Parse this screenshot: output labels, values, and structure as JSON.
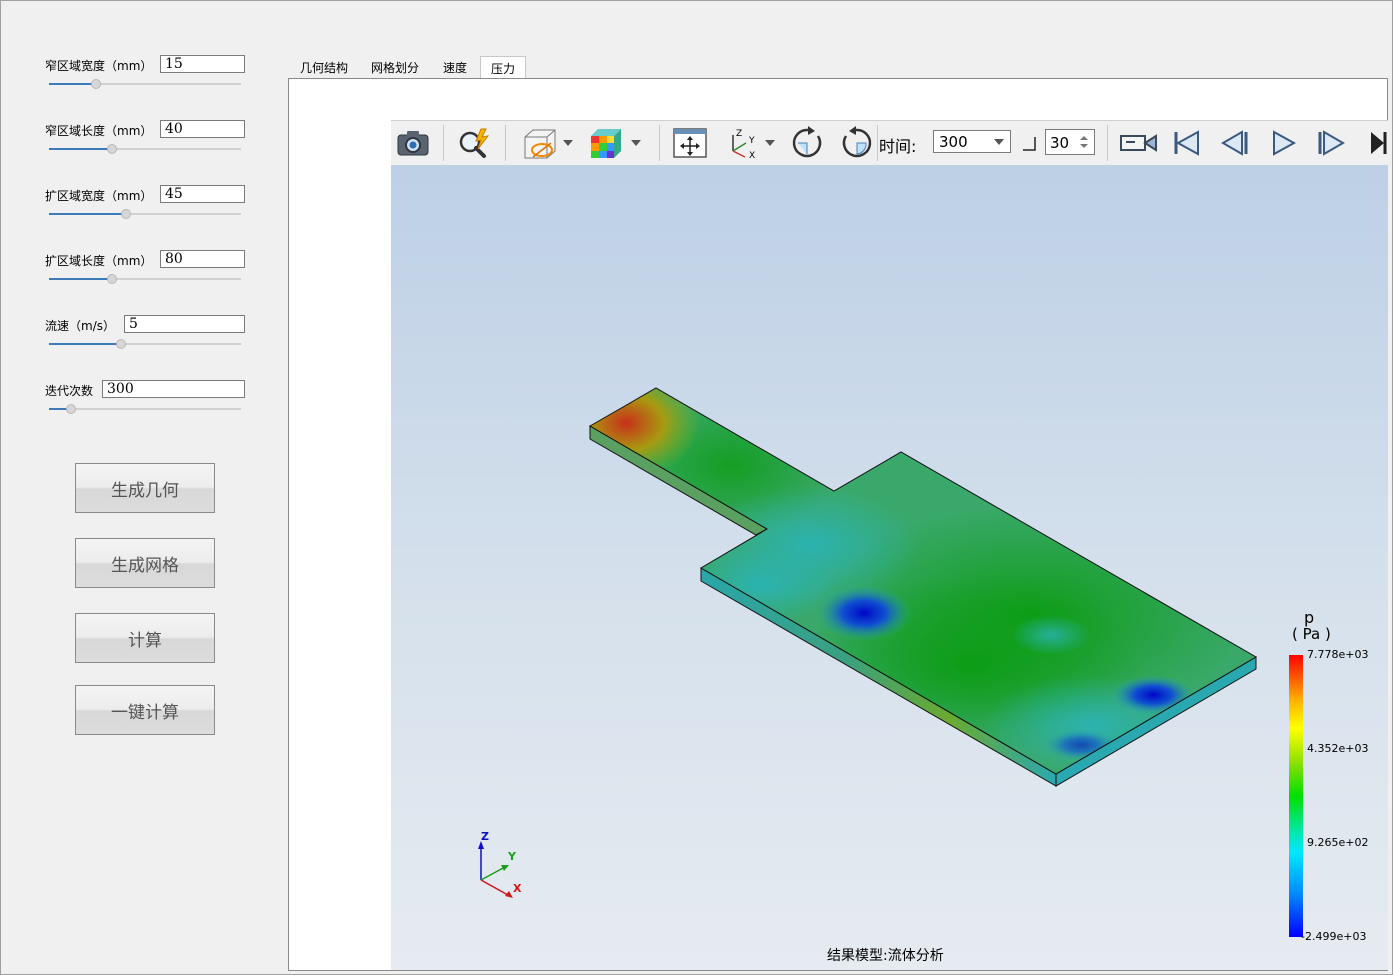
{
  "params": [
    {
      "label": "窄区域宽度（mm）",
      "value": "15",
      "fraction": 0.24
    },
    {
      "label": "窄区域长度（mm）",
      "value": "40",
      "fraction": 0.32
    },
    {
      "label": "扩区域宽度（mm）",
      "value": "45",
      "fraction": 0.4
    },
    {
      "label": "扩区域长度（mm）",
      "value": "80",
      "fraction": 0.32
    },
    {
      "label": "流速（m/s）",
      "value": "5",
      "fraction": 0.38
    },
    {
      "label": "迭代次数",
      "value": "300",
      "fraction": 0.11
    }
  ],
  "buttons": {
    "generate_geometry": "生成几何",
    "generate_mesh": "生成网格",
    "compute": "计算",
    "one_click": "一键计算"
  },
  "tabs": [
    {
      "label": "几何结构",
      "active": false
    },
    {
      "label": "网格划分",
      "active": false
    },
    {
      "label": "速度",
      "active": false
    },
    {
      "label": "压力",
      "active": true
    }
  ],
  "toolbar": {
    "time_label": "时间:",
    "time_value": "300",
    "step_value": "30"
  },
  "colorbar": {
    "title": "p",
    "unit": "( Pa )",
    "max": "7.778e+03",
    "mid_high": "4.352e+03",
    "mid_low": "9.265e+02",
    "min": "-2.499e+03"
  },
  "axes": {
    "z": "Z",
    "y": "Y",
    "x": "X"
  },
  "caption": "结果模型:流体分析"
}
